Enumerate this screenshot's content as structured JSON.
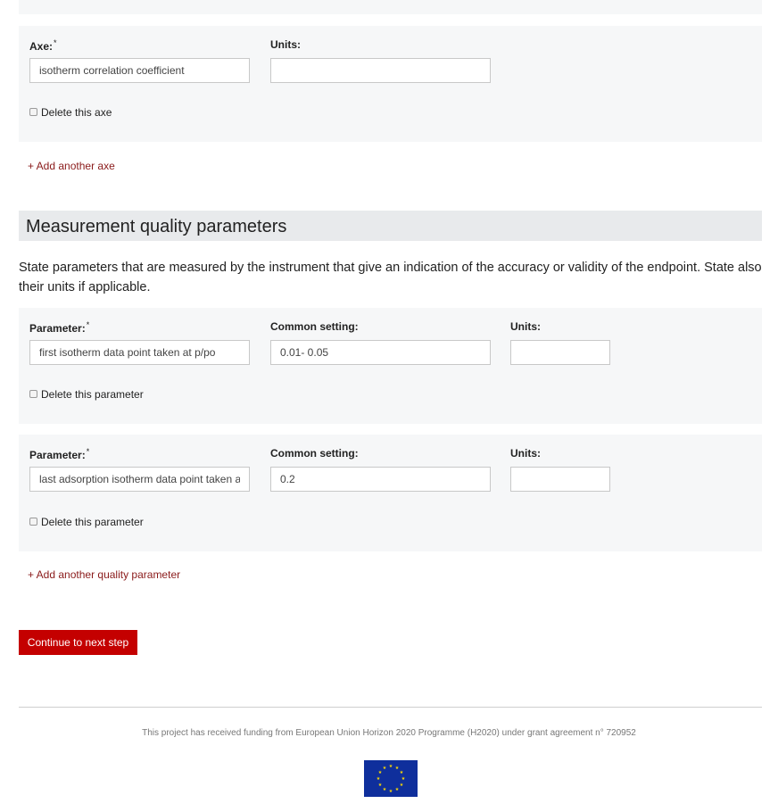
{
  "axe_block": {
    "axe_label": "Axe:",
    "required_mark": "*",
    "axe_value": "isotherm correlation coefficient",
    "units_label": "Units:",
    "units_value": "",
    "delete_label": "Delete this axe"
  },
  "add_axe_link": "+ Add another axe",
  "quality": {
    "title": "Measurement quality parameters",
    "description": "State parameters that are measured by the instrument that give an indication of the accuracy or validity of the endpoint. State also their units if applicable.",
    "parameters": [
      {
        "parameter_label": "Parameter:",
        "required_mark": "*",
        "parameter_value": "first isotherm data point taken at p/po",
        "setting_label": "Common setting:",
        "setting_value": "0.01- 0.05",
        "units_label": "Units:",
        "units_value": "",
        "delete_label": "Delete this parameter"
      },
      {
        "parameter_label": "Parameter:",
        "required_mark": "*",
        "parameter_value": "last adsorption isotherm data point taken at p/po",
        "setting_label": "Common setting:",
        "setting_value": "0.2",
        "units_label": "Units:",
        "units_value": "",
        "delete_label": "Delete this parameter"
      }
    ],
    "add_parameter_link": "+ Add another quality parameter"
  },
  "continue_button": "Continue to next step",
  "footer": {
    "funding_text": "This project has received funding from European Union Horizon 2020 Programme (H2020) under grant agreement n° 720952",
    "flag_icon": "eu-flag-icon"
  },
  "colors": {
    "accent_red": "#c40000",
    "link_red": "#8a1a1a",
    "panel_bg": "#f6f7f8",
    "eu_blue": "#0f2f9c",
    "eu_yellow": "#ffdd00"
  }
}
